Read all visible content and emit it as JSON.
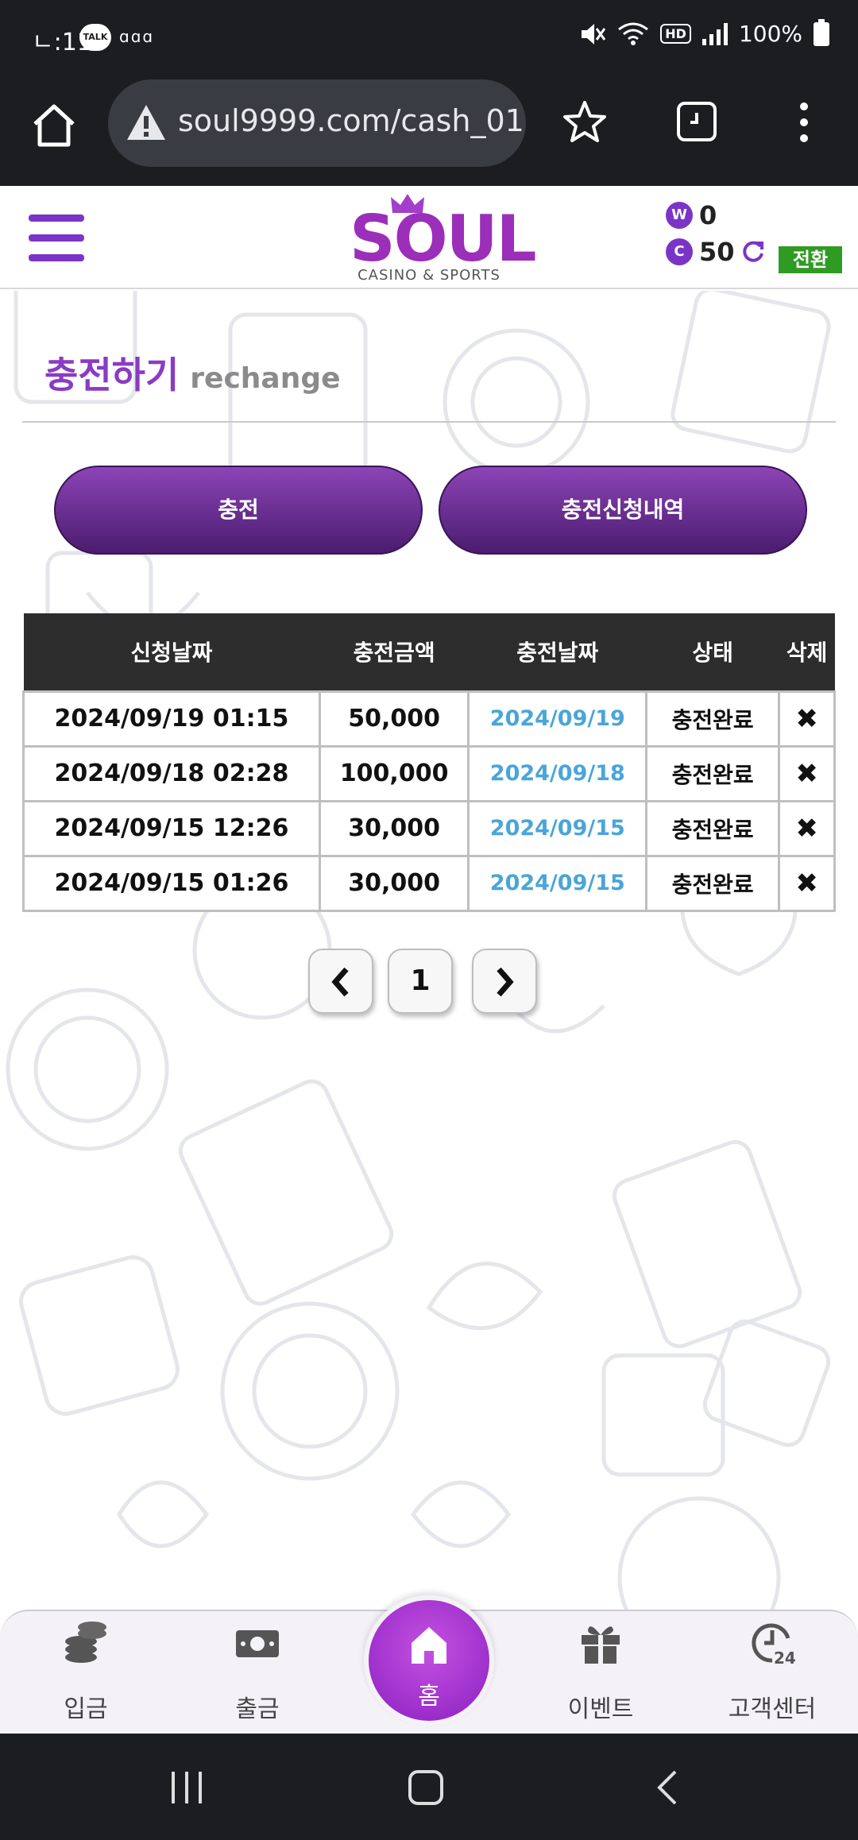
{
  "status_bar": {
    "time": "오후 2:11",
    "time_display": "ㄴ:11",
    "talk_badge": "TALK",
    "extra": "ɑɑɑ",
    "hd": "HD",
    "battery": "100%"
  },
  "browser": {
    "url": "soul9999.com/cash_01"
  },
  "header": {
    "logo_text": "SOUL",
    "logo_sub": "CASINO & SPORTS",
    "wallet_w_badge": "W",
    "wallet_w_value": "0",
    "wallet_c_badge": "C",
    "wallet_c_value": "50",
    "convert_label": "전환"
  },
  "page": {
    "title_ko": "충전하기",
    "title_en": "rechange",
    "tab_charge": "충전",
    "tab_history": "충전신청내역"
  },
  "table": {
    "headers": [
      "신청날짜",
      "충전금액",
      "충전날짜",
      "상태",
      "삭제"
    ],
    "rows": [
      {
        "request_date": "2024/09/19 01:15",
        "amount": "50,000",
        "charge_date": "2024/09/19",
        "status": "충전완료",
        "delete": "✖"
      },
      {
        "request_date": "2024/09/18 02:28",
        "amount": "100,000",
        "charge_date": "2024/09/18",
        "status": "충전완료",
        "delete": "✖"
      },
      {
        "request_date": "2024/09/15 12:26",
        "amount": "30,000",
        "charge_date": "2024/09/15",
        "status": "충전완료",
        "delete": "✖"
      },
      {
        "request_date": "2024/09/15 01:26",
        "amount": "30,000",
        "charge_date": "2024/09/15",
        "status": "충전완료",
        "delete": "✖"
      }
    ]
  },
  "pagination": {
    "prev": "‹",
    "current": "1",
    "next": "›"
  },
  "bottom_nav": {
    "deposit": "입금",
    "withdraw": "출금",
    "home": "홈",
    "event": "이벤트",
    "support": "고객센터"
  },
  "colors": {
    "brand_purple": "#8a3bc3",
    "date_blue": "#4aa5d8",
    "convert_green": "#2f9b23"
  }
}
